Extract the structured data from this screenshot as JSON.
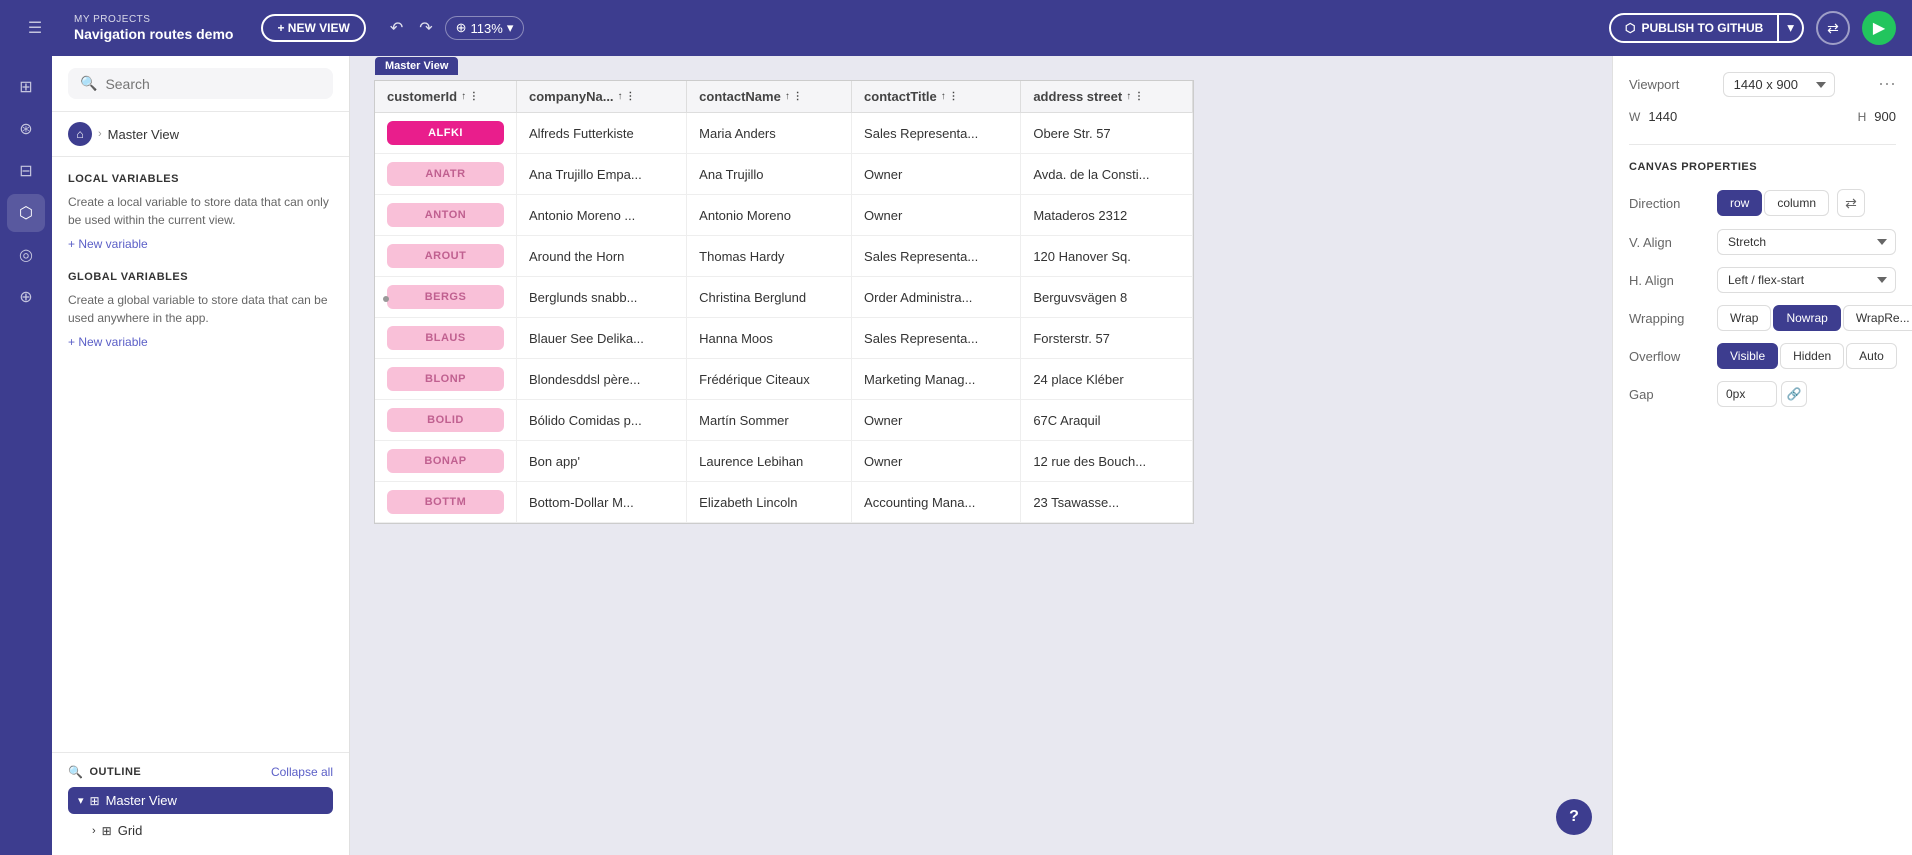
{
  "topbar": {
    "my_projects_label": "MY PROJECTS",
    "project_name": "Navigation routes demo",
    "new_view_btn": "+ NEW VIEW",
    "zoom_level": "113%",
    "publish_btn": "PUBLISH TO GITHUB",
    "github_icon": "github-icon",
    "undo_icon": "undo-icon",
    "redo_icon": "redo-icon",
    "zoom_icon": "zoom-icon",
    "share_icon": "share-icon",
    "play_icon": "play-icon"
  },
  "left_panel": {
    "search_placeholder": "Search",
    "master_view_label": "Master View",
    "local_variables_title": "LOCAL VARIABLES",
    "local_variables_desc": "Create a local variable to store data that can only be used within the current view.",
    "new_variable_link": "+ New variable",
    "global_variables_title": "GLOBAL VARIABLES",
    "global_variables_desc": "Create a global variable to store data that can be used anywhere in the app.",
    "global_new_variable_link": "+ New variable",
    "outline_title": "OUTLINE",
    "collapse_all": "Collapse all",
    "master_view_item": "Master View",
    "grid_item": "Grid"
  },
  "canvas": {
    "frame_label": "Master View",
    "columns": [
      "customerId",
      "companyNa...",
      "contactName",
      "contactTitle",
      "address street"
    ],
    "rows": [
      {
        "id": "ALFKI",
        "company": "Alfreds Futterkiste",
        "contact": "Maria Anders",
        "title": "Sales Representa...",
        "address": "Obere Str. 57",
        "active": true
      },
      {
        "id": "ANATR",
        "company": "Ana Trujillo Empa...",
        "contact": "Ana Trujillo",
        "title": "Owner",
        "address": "Avda. de la Consti...",
        "active": false
      },
      {
        "id": "ANTON",
        "company": "Antonio Moreno ...",
        "contact": "Antonio Moreno",
        "title": "Owner",
        "address": "Mataderos 2312",
        "active": false
      },
      {
        "id": "AROUT",
        "company": "Around the Horn",
        "contact": "Thomas Hardy",
        "title": "Sales Representa...",
        "address": "120 Hanover Sq.",
        "active": false
      },
      {
        "id": "BERGS",
        "company": "Berglunds snabb...",
        "contact": "Christina Berglund",
        "title": "Order Administra...",
        "address": "Berguvsvägen 8",
        "active": false
      },
      {
        "id": "BLAUS",
        "company": "Blauer See Delika...",
        "contact": "Hanna Moos",
        "title": "Sales Representa...",
        "address": "Forsterstr. 57",
        "active": false
      },
      {
        "id": "BLONP",
        "company": "Blondesddsl père...",
        "contact": "Frédérique Citeaux",
        "title": "Marketing Manag...",
        "address": "24 place Kléber",
        "active": false
      },
      {
        "id": "BOLID",
        "company": "Bólido Comidas p...",
        "contact": "Martín Sommer",
        "title": "Owner",
        "address": "67C Araquil",
        "active": false
      },
      {
        "id": "BONAP",
        "company": "Bon app'",
        "contact": "Laurence Lebihan",
        "title": "Owner",
        "address": "12 rue des Bouch...",
        "active": false
      },
      {
        "id": "BOTTM",
        "company": "Bottom-Dollar M...",
        "contact": "Elizabeth Lincoln",
        "title": "Accounting Mana...",
        "address": "23 Tsawasse...",
        "active": false
      }
    ]
  },
  "right_panel": {
    "viewport_label": "Viewport",
    "viewport_value": "1440 x 900",
    "w_label": "W",
    "w_value": "1440",
    "h_label": "H",
    "h_value": "900",
    "canvas_props_title": "CANVAS PROPERTIES",
    "direction_label": "Direction",
    "row_btn": "row",
    "column_btn": "column",
    "swap_icon": "swap-icon",
    "v_align_label": "V. Align",
    "v_align_value": "Stretch",
    "h_align_label": "H. Align",
    "h_align_value": "Left / flex-start",
    "wrapping_label": "Wrapping",
    "wrap_btn": "Wrap",
    "nowrap_btn": "Nowrap",
    "wrapre_btn": "WrapRe...",
    "overflow_label": "Overflow",
    "visible_btn": "Visible",
    "hidden_btn": "Hidden",
    "auto_btn": "Auto",
    "gap_label": "Gap",
    "gap_value": "0px",
    "gap_link_icon": "link-icon"
  },
  "help_btn_label": "?"
}
